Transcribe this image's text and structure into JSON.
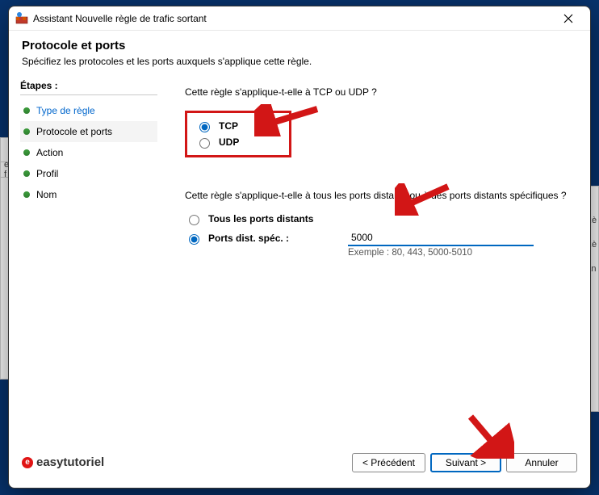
{
  "window": {
    "title": "Assistant Nouvelle règle de trafic sortant"
  },
  "header": {
    "heading": "Protocole et ports",
    "subtitle": "Spécifiez les protocoles et les ports auxquels s'applique cette règle."
  },
  "steps": {
    "title": "Étapes :",
    "items": [
      {
        "label": "Type de règle",
        "link": true,
        "current": false
      },
      {
        "label": "Protocole et ports",
        "link": false,
        "current": true
      },
      {
        "label": "Action",
        "link": false,
        "current": false
      },
      {
        "label": "Profil",
        "link": false,
        "current": false
      },
      {
        "label": "Nom",
        "link": false,
        "current": false
      }
    ]
  },
  "main": {
    "q1": "Cette règle s'applique-t-elle à TCP ou UDP ?",
    "protocol": {
      "tcp": "TCP",
      "udp": "UDP",
      "selected": "tcp"
    },
    "q2": "Cette règle s'applique-t-elle à tous les ports distants ou à des ports distants spécifiques ?",
    "ports": {
      "all_label": "Tous les ports distants",
      "spec_label": "Ports dist. spéc. :",
      "selected": "spec",
      "value": "5000",
      "example": "Exemple : 80, 443, 5000-5010"
    }
  },
  "footer": {
    "watermark": "easytutoriel",
    "back": "< Précédent",
    "next": "Suivant >",
    "cancel": "Annuler"
  }
}
